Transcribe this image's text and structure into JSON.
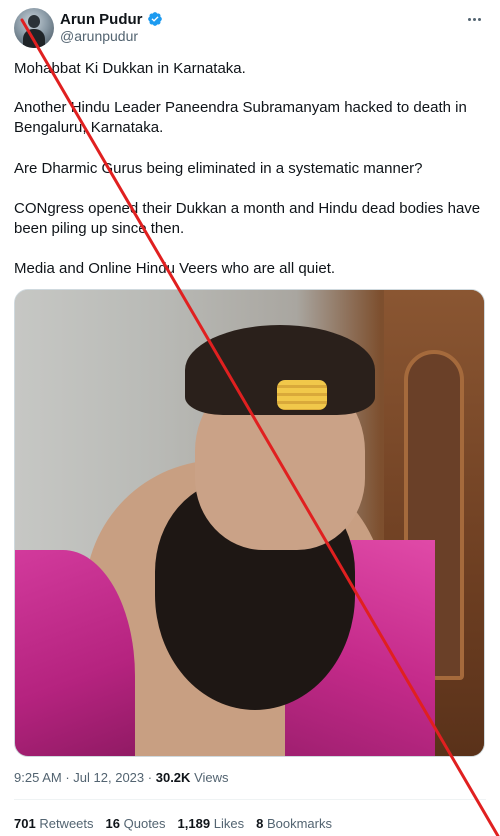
{
  "author": {
    "name": "Arun Pudur",
    "handle": "@arunpudur"
  },
  "icons": {
    "avatar": "user-avatar",
    "verified": "verified-badge-icon",
    "more": "more-options-icon"
  },
  "colors": {
    "verified": "#1d9bf0",
    "strike_line": "#e02020",
    "secondary_text": "#536471"
  },
  "tweet": {
    "lines": [
      "Mohabbat Ki Dukkan in Karnataka.",
      "Another Hindu Leader Paneendra Subramanyam  hacked to death in",
      "Bengaluru, Karnataka.",
      "Are Dharmic Gurus being eliminated in a systematic manner?",
      "CONgress opened their Dukkan a month and Hindu dead bodies have",
      "been piling up since then.",
      "Media and Online Hindu Veers who are all quiet."
    ]
  },
  "meta": {
    "time": "9:25 AM",
    "separator": "·",
    "date": "Jul 12, 2023",
    "views_count": "30.2K",
    "views_label": "Views"
  },
  "stats": {
    "retweets_count": "701",
    "retweets_label": "Retweets",
    "quotes_count": "16",
    "quotes_label": "Quotes",
    "likes_count": "1,189",
    "likes_label": "Likes",
    "bookmarks_count": "8",
    "bookmarks_label": "Bookmarks"
  }
}
